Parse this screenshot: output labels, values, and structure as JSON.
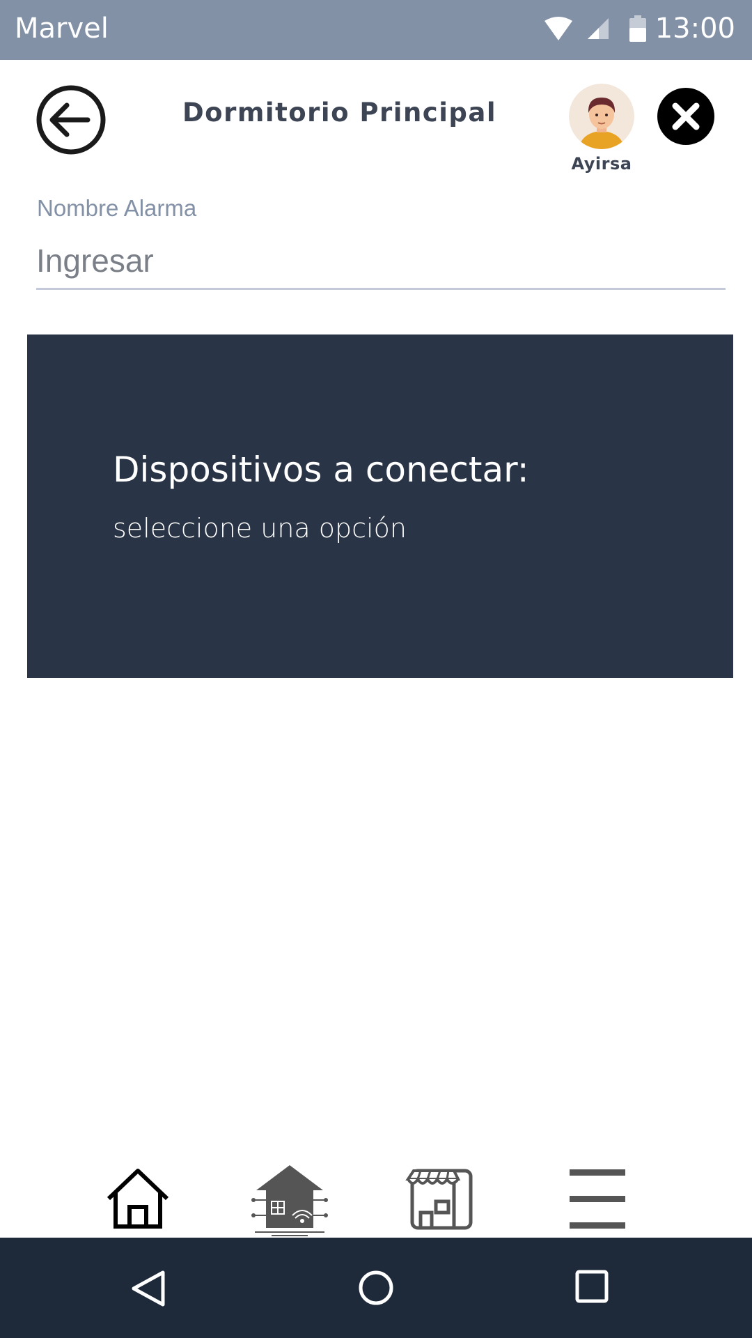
{
  "status_bar": {
    "app_name": "Marvel",
    "time": "13:00",
    "icons": [
      "wifi-icon",
      "cell-signal-icon",
      "battery-icon"
    ]
  },
  "header": {
    "back_icon": "arrow-left-circle-icon",
    "title": "Dormitorio Principal",
    "user": {
      "name": "Ayirsa",
      "avatar": "avatar-icon"
    },
    "close_icon": "close-icon"
  },
  "form": {
    "field_label": "Nombre Alarma",
    "field_placeholder": "Ingresar",
    "field_value": ""
  },
  "devices_panel": {
    "title": "Dispositivos a conectar:",
    "subtitle": "seleccione una opción",
    "background": "#293446"
  },
  "bottom_nav": {
    "items": [
      {
        "icon": "home-icon"
      },
      {
        "icon": "smart-home-icon"
      },
      {
        "icon": "store-icon"
      },
      {
        "icon": "menu-icon"
      }
    ]
  },
  "system_nav": {
    "items": [
      "back-triangle-icon",
      "home-circle-icon",
      "recents-square-icon"
    ]
  },
  "colors": {
    "status_bar": "#8391a6",
    "panel": "#293446",
    "system_nav": "#1e2a3a",
    "title_text": "#3d4554"
  }
}
